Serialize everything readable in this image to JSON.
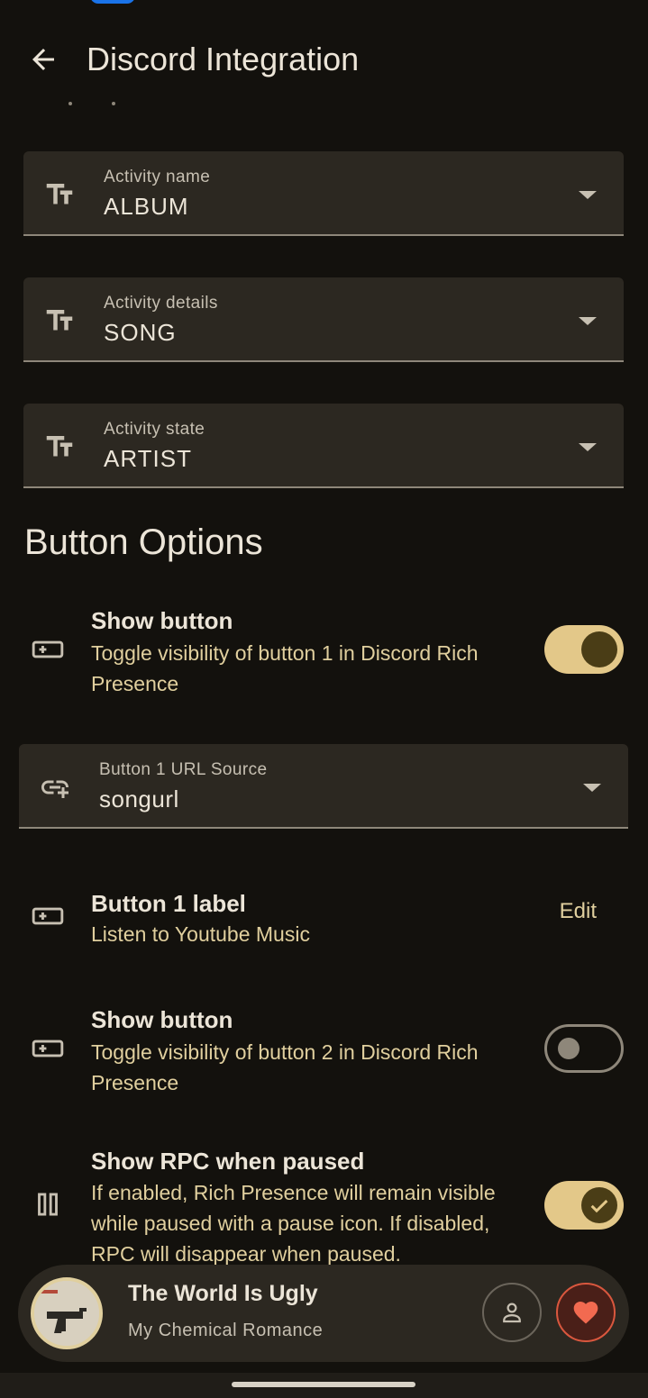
{
  "app_bar": {
    "title": "Discord Integration"
  },
  "dropdowns": [
    {
      "label": "Activity name",
      "value": "ALBUM"
    },
    {
      "label": "Activity details",
      "value": "SONG"
    },
    {
      "label": "Activity state",
      "value": "ARTIST"
    }
  ],
  "button_options": {
    "title": "Button Options",
    "show_button_1": {
      "title": "Show button",
      "subtitle": "Toggle visibility of button 1 in Discord Rich Presence",
      "enabled": true
    },
    "url_source": {
      "label": "Button 1 URL Source",
      "value": "songurl"
    },
    "button_1_label": {
      "title": "Button 1 label",
      "subtitle": "Listen to Youtube Music",
      "action": "Edit"
    },
    "show_button_2": {
      "title": "Show button",
      "subtitle": "Toggle visibility of button 2 in Discord Rich Presence",
      "enabled": false
    },
    "show_rpc_paused": {
      "title": "Show RPC when paused",
      "subtitle": "If enabled, Rich Presence will remain visible while paused with a pause icon. If disabled, RPC will disappear when paused.",
      "enabled": true
    }
  },
  "mini_player": {
    "title": "The World Is Ugly",
    "artist": "My Chemical Romance"
  },
  "colors": {
    "background": "#13110d",
    "surface": "#2c2821",
    "accent": "#e3c889",
    "like_red": "#f26a50"
  },
  "icons": {
    "back": "arrow-left-icon",
    "text_format": "text-fields-icon",
    "button": "smart-button-icon",
    "link": "add-link-icon",
    "pause": "pause-icon",
    "account": "person-icon",
    "like": "heart-icon",
    "dropdown": "chevron-down-icon"
  }
}
